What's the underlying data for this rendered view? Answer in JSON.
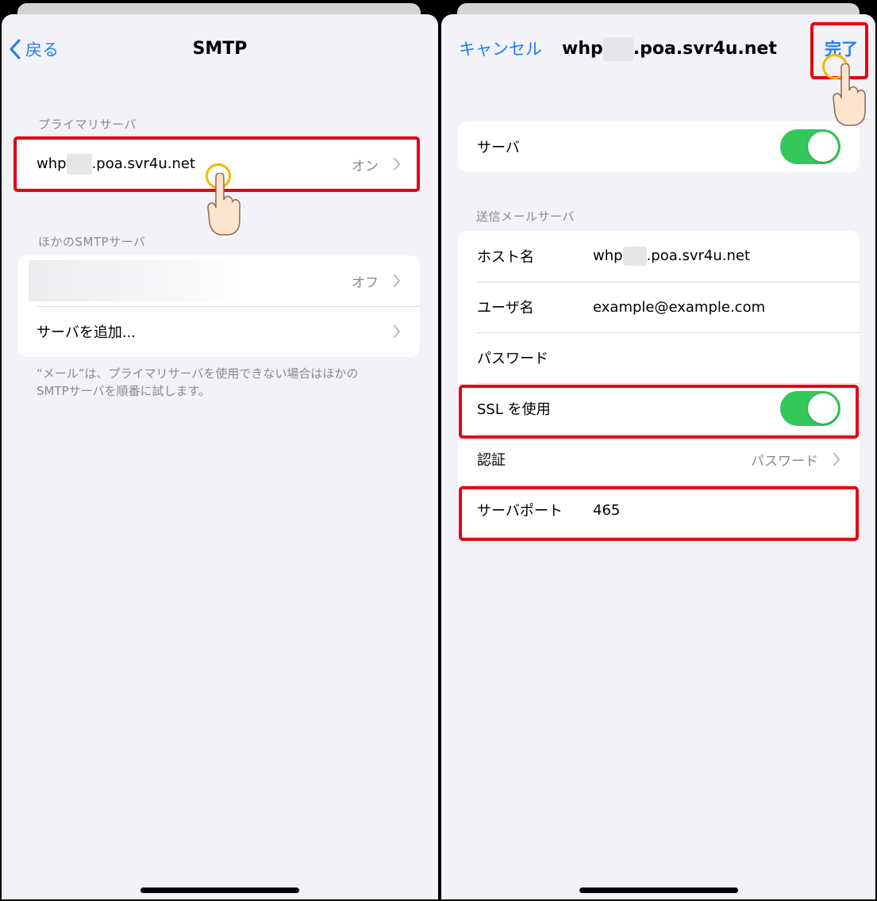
{
  "left": {
    "nav": {
      "back_label": "戻る",
      "title": "SMTP"
    },
    "primary_section": {
      "label": "プライマリサーバ",
      "server_prefix": "whp",
      "server_suffix": ".poa.svr4u.net",
      "status": "オン"
    },
    "other_section": {
      "label": "ほかのSMTPサーバ",
      "blurred_status": "オフ",
      "add_label": "サーバを追加..."
    },
    "footer_line1": "“メール”は、プライマリサーバを使用できない場合はほかの",
    "footer_line2": "SMTPサーバを順番に試します。"
  },
  "right": {
    "nav": {
      "cancel_label": "キャンセル",
      "title_prefix": "whp",
      "title_suffix": ".poa.svr4u.net",
      "done_label": "完了"
    },
    "server_row": {
      "label": "サーバ",
      "on": true
    },
    "outgoing_section": {
      "label": "送信メールサーバ",
      "host_label": "ホスト名",
      "host_prefix": "whp",
      "host_suffix": ".poa.svr4u.net",
      "user_label": "ユーザ名",
      "user_value": "example@example.com",
      "password_label": "パスワード",
      "ssl_label": "SSL を使用",
      "ssl_on": true,
      "auth_label": "認証",
      "auth_value": "パスワード",
      "port_label": "サーバポート",
      "port_value": "465"
    }
  },
  "colors": {
    "accent": "#1f7cf5",
    "toggle_on": "#34c759",
    "highlight": "#e60012",
    "tap_circle": "#f5b800"
  }
}
